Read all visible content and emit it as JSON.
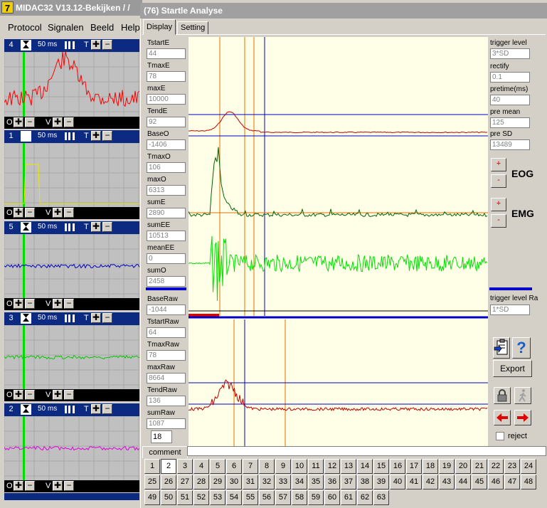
{
  "main_window": {
    "title": "MIDAC32 V13.12-Bekijken / / ",
    "logo_text": "7",
    "menu": [
      "Protocol",
      "Signalen",
      "Beeld",
      "Help"
    ]
  },
  "channels": [
    {
      "number": "4",
      "time_label": "50 ms",
      "color": "#ff0000"
    },
    {
      "number": "1",
      "time_label": "50 ms",
      "color": "#e8e800"
    },
    {
      "number": "5",
      "time_label": "50 ms",
      "color": "#0000c8"
    },
    {
      "number": "3",
      "time_label": "50 ms",
      "color": "#00c800"
    },
    {
      "number": "2",
      "time_label": "50 ms",
      "color": "#e000e0"
    }
  ],
  "channel_controls": {
    "t_label": "T",
    "o_label": "O",
    "v_label": "V"
  },
  "dialog": {
    "title": "(76) Startle Analyse",
    "tabs": [
      "Display",
      "Setting"
    ],
    "left_fields": [
      {
        "label": "TstartE",
        "value": "44"
      },
      {
        "label": "TmaxE",
        "value": "78"
      },
      {
        "label": "maxE",
        "value": "10000"
      },
      {
        "label": "TendE",
        "value": "92"
      },
      {
        "label": "BaseO",
        "value": "-1406"
      },
      {
        "label": "TmaxO",
        "value": "106"
      },
      {
        "label": "maxO",
        "value": "6313"
      },
      {
        "label": "sumE",
        "value": "2890"
      },
      {
        "label": "sumEE",
        "value": "10513"
      },
      {
        "label": "meanEE",
        "value": "0"
      },
      {
        "label": "sumO",
        "value": "2458"
      },
      {
        "label": "BaseRaw",
        "value": "-1044"
      },
      {
        "label": "TstartRaw",
        "value": "64"
      },
      {
        "label": "TmaxRaw",
        "value": "78"
      },
      {
        "label": "maxRaw",
        "value": "8664"
      },
      {
        "label": "TendRaw",
        "value": "136"
      },
      {
        "label": "sumRaw",
        "value": "1087"
      }
    ],
    "spin_value": "18",
    "right_fields": [
      {
        "label": "trigger level",
        "value": "3*SD"
      },
      {
        "label": "rectify",
        "value": "0.1"
      },
      {
        "label": "pretime(ms)",
        "value": "40"
      },
      {
        "label": "pre mean",
        "value": "125"
      },
      {
        "label": "pre  SD",
        "value": "13489"
      }
    ],
    "eog_label": "EOG",
    "emg_label": "EMG",
    "plus": "+",
    "minus": "-",
    "trigger_raw": {
      "label": "trigger level Ra",
      "value": "1*SD"
    },
    "export_label": "Export",
    "reject_label": "reject",
    "comment_label": "comment",
    "comment_value": "",
    "selected_trial": 2,
    "trials": [
      1,
      2,
      3,
      4,
      5,
      6,
      7,
      8,
      9,
      10,
      11,
      12,
      13,
      14,
      15,
      16,
      17,
      18,
      19,
      20,
      21,
      22,
      23,
      24,
      25,
      26,
      27,
      28,
      29,
      30,
      31,
      32,
      33,
      34,
      35,
      36,
      37,
      38,
      39,
      40,
      41,
      42,
      43,
      44,
      45,
      46,
      47,
      48,
      49,
      50,
      51,
      52,
      53,
      54,
      55,
      56,
      57,
      58,
      59,
      60,
      61,
      62,
      63
    ]
  },
  "colors": {
    "title_bar": "#0c2a82",
    "plot_bg": "#ffffe8",
    "eog": "#c00000",
    "emg": "#006400",
    "raw_emg": "#00e000",
    "cursor_orange": "#e07000",
    "cursor_blue": "#0000c0"
  }
}
